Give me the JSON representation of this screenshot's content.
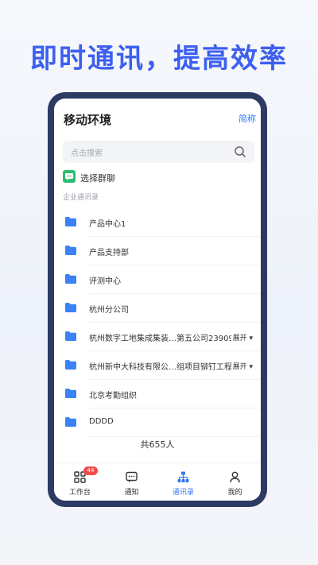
{
  "headline": "即时通讯，提高效率",
  "header": {
    "title": "移动环境",
    "lang_toggle": "简称"
  },
  "search": {
    "placeholder": "点击搜索"
  },
  "group_chat": {
    "label": "选择群聊"
  },
  "section_label": "企业通讯录",
  "departments": [
    {
      "name": "产品中心1"
    },
    {
      "name": "产品支持部"
    },
    {
      "name": "评测中心"
    },
    {
      "name": "杭州分公司"
    },
    {
      "name": "杭州数字工地集成集装…第五公司23909号",
      "expand": "展开"
    },
    {
      "name": "杭州新中大科技有限公…组项目铆钉工程计",
      "expand": "展开"
    },
    {
      "name": "北京考勤组织"
    },
    {
      "name": "DDDD"
    }
  ],
  "total": "共655人",
  "tabs": [
    {
      "label": "工作台",
      "badge": "44"
    },
    {
      "label": "通知"
    },
    {
      "label": "通讯录",
      "active": true
    },
    {
      "label": "我的"
    }
  ],
  "colors": {
    "accent": "#3478f6",
    "headline": "#3d5ff0",
    "frame": "#2d3a63",
    "badge": "#f24a4a",
    "group_icon": "#2fbd72"
  }
}
